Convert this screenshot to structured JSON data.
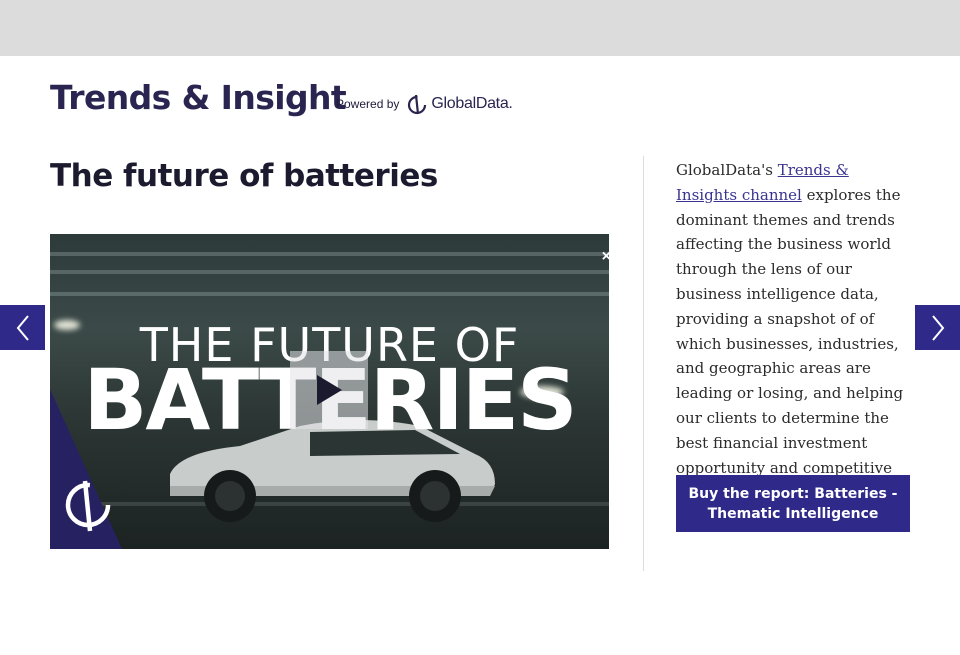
{
  "header": {
    "brand_title": "Trends & Insight",
    "powered_by_label": "Powered by",
    "partner_name": "GlobalData."
  },
  "article": {
    "title": "The future of batteries",
    "video": {
      "headline_line1": "THE FUTURE OF",
      "headline_line2": "BATTERIES",
      "close_label": "×"
    },
    "description_before_link": "GlobalData's ",
    "description_link": "Trends & Insights channel",
    "description_after_link": " explores the dominant themes and trends affecting the business world through the lens of our business intelligence data, providing a snapshot of of which businesses, industries, and geographic areas are leading or losing, and helping our clients to determine the best financial investment opportunity and competitive business strategy.",
    "buy_button_label": "Buy the report: Batteries - Thematic Intelligence"
  },
  "carousel": {
    "prev_icon": "chevron-left-icon",
    "next_icon": "chevron-right-icon"
  },
  "colors": {
    "accent": "#2f2a8a",
    "brand_text": "#2a2550",
    "top_bar": "#dcdcdc"
  }
}
